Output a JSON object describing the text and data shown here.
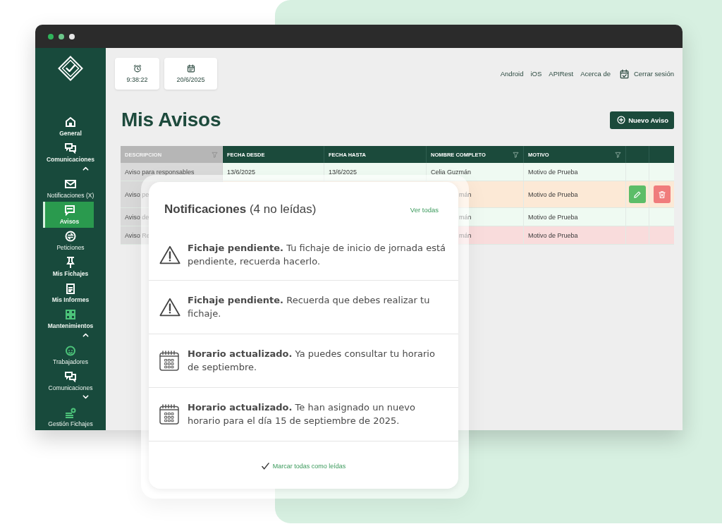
{
  "sidebar": {
    "items": [
      {
        "label": "General",
        "selected": false,
        "color": "#ffffff"
      },
      {
        "label": "Comunicaciones",
        "selected": false,
        "color": "#ffffff",
        "expanded": true,
        "children": [
          {
            "label": "Notificaciones (X)",
            "selected": false,
            "color": "#ffffff"
          },
          {
            "label": "Avisos",
            "selected": true,
            "color": "#ffffff"
          },
          {
            "label": "Peticiones",
            "selected": false,
            "color": "#ffffff"
          }
        ]
      },
      {
        "label": "Mis Fichajes",
        "selected": false,
        "color": "#ffffff"
      },
      {
        "label": "Mis Informes",
        "selected": false,
        "color": "#ffffff"
      },
      {
        "label": "Mantenimientos",
        "selected": false,
        "color": "#4cc47a",
        "expanded": true,
        "children": [
          {
            "label": "Trabajadores",
            "selected": false,
            "color": "#4cc47a"
          },
          {
            "label": "Comunicaciones",
            "selected": false,
            "color": "#ffffff",
            "expanded": false
          },
          {
            "label": "Gestión Fichajes",
            "selected": false,
            "color": "#4cc47a"
          }
        ]
      }
    ]
  },
  "top_bar": {
    "clock": "9:38:22",
    "date": "20/6/2025",
    "links": [
      "Android",
      "iOS",
      "APIRest",
      "Acerca de"
    ],
    "logout": "Cerrar sesión"
  },
  "page": {
    "title": "Mis Avisos",
    "new_button": "Nuevo Aviso"
  },
  "table": {
    "columns": [
      {
        "kind": "data",
        "label": "DESCRIPCION",
        "filter": true,
        "highlighted": true
      },
      {
        "kind": "data",
        "label": "FECHA DESDE",
        "filter": false,
        "highlighted": false
      },
      {
        "kind": "data",
        "label": "FECHA HASTA",
        "filter": false,
        "highlighted": false
      },
      {
        "kind": "data",
        "label": "NOMBRE COMPLETO",
        "filter": true,
        "highlighted": false
      },
      {
        "kind": "data",
        "label": "MOTIVO",
        "filter": true,
        "highlighted": false
      },
      {
        "kind": "action"
      },
      {
        "kind": "action"
      }
    ],
    "rows": [
      {
        "color": "#effaf2",
        "cells": [
          "Aviso para responsables",
          "13/6/2025",
          "13/6/2025",
          "Celia Guzmán",
          "Motivo de Prueba"
        ]
      },
      {
        "color": "#fce9d6",
        "cells": [
          "Aviso pe",
          null,
          null,
          "mán",
          "Motivo de Prueba"
        ],
        "actions": [
          {
            "kind": "edit"
          },
          {
            "kind": "delete"
          }
        ]
      },
      {
        "color": "#effaf2",
        "cells": [
          "Aviso de",
          null,
          null,
          "mán",
          "Motivo de Prueba"
        ]
      },
      {
        "color": "#f9dcdc",
        "cells": [
          "Aviso Re",
          null,
          null,
          "mán",
          "Motivo de Prueba"
        ]
      }
    ]
  },
  "notifications": {
    "title": "**Notificaciones** (4 no leídas)",
    "view_all": "Ver todas",
    "items": [
      {
        "kind": "warning",
        "text": "**Fichaje pendiente.** Tu fichaje de inicio de jornada está pendiente, recuerda hacerlo."
      },
      {
        "kind": "warning",
        "text": "**Fichaje pendiente.** Recuerda que debes realizar tu fichaje."
      },
      {
        "kind": "calendar",
        "text": "**Horario actualizado.** Ya puedes consultar tu horario de septiembre."
      },
      {
        "kind": "calendar",
        "text": "**Horario actualizado.** Te han asignado un nuevo horario para el día 15 de septiembre de 2025."
      }
    ],
    "mark_all": "Marcar todas como leídas"
  }
}
